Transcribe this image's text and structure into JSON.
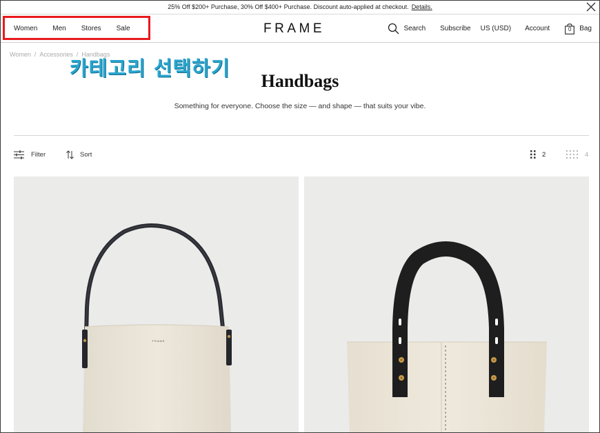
{
  "promo": {
    "text": "25% Off $200+ Purchase, 30% Off $400+ Purchase. Discount auto-applied at checkout.",
    "link": "Details."
  },
  "nav_left": [
    {
      "label": "Women"
    },
    {
      "label": "Men"
    },
    {
      "label": "Stores"
    },
    {
      "label": "Sale"
    }
  ],
  "logo": "FRAME",
  "nav_right": {
    "search": "Search",
    "subscribe": "Subscribe",
    "currency": "US (USD)",
    "account": "Account",
    "bag": "Bag",
    "bag_count": "0"
  },
  "breadcrumb": [
    "Women",
    "/",
    "Accessories",
    "/",
    "Handbags"
  ],
  "annotation": {
    "text": "카테고리 선택하기",
    "color": "#29a5cf",
    "highlight_color": "#e8191d"
  },
  "page": {
    "title": "Handbags",
    "subtitle": "Something for everyone. Choose the size — and shape — that suits your vibe."
  },
  "toolbar": {
    "filter": "Filter",
    "sort": "Sort",
    "grid_2": "2",
    "grid_4": "4",
    "active_grid": "2"
  },
  "products": [
    {
      "icon": "bucket-bag-cream-image",
      "brand_stamp": "FRAME"
    },
    {
      "icon": "canvas-tote-cream-image"
    }
  ],
  "colors": {
    "product_bg": "#ebebea",
    "bag_cream": "#ece6da",
    "strap_black": "#1e1e1e"
  }
}
